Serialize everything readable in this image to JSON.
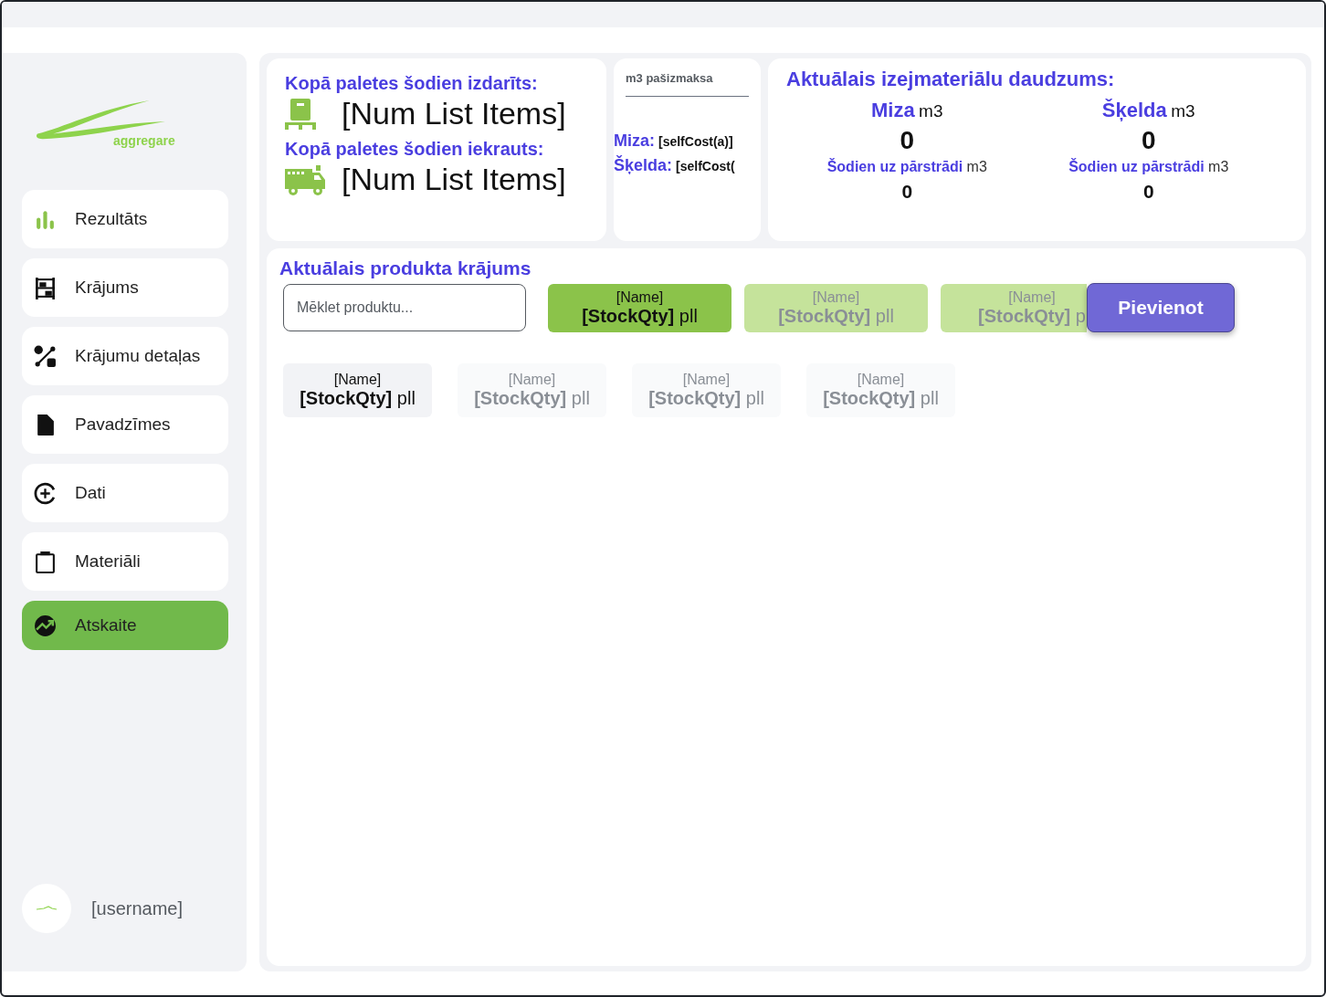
{
  "brand": {
    "name": "aggregare"
  },
  "nav": [
    {
      "label": "Rezultāts",
      "kind": "bars",
      "selected": false
    },
    {
      "label": "Krājums",
      "kind": "shelf",
      "selected": false
    },
    {
      "label": "Krājumu detaļas",
      "kind": "shapes",
      "selected": false
    },
    {
      "label": "Pavadzīmes",
      "kind": "file",
      "selected": false
    },
    {
      "label": "Dati",
      "kind": "circleplus",
      "selected": false
    },
    {
      "label": "Materiāli",
      "kind": "clipboard",
      "selected": false
    },
    {
      "label": "Atskaite",
      "kind": "chart",
      "selected": true
    }
  ],
  "user": {
    "name": "[username]"
  },
  "pallets": [
    {
      "title": "Kopā paletes šodien izdarīts:",
      "kind": "pallet",
      "value": "[Num List Items]"
    },
    {
      "title": "Kopā paletes šodien iekrauts:",
      "kind": "truck",
      "value": "[Num List Items]"
    }
  ],
  "self_cost": {
    "title": "m3 pašizmaksa",
    "rows": [
      {
        "label": "Miza:",
        "value": "[selfCost(a)]"
      },
      {
        "label": "Šķelda:",
        "value": "[selfCost("
      }
    ]
  },
  "materials": {
    "title": "Aktuālais izejmateriālu daudzums:",
    "items": [
      {
        "name": "Miza",
        "unit": "m3",
        "amount": "0",
        "today_label": "Šodien uz pārstrādi",
        "today_unit": "m3",
        "today_amount": "0"
      },
      {
        "name": "Šķelda",
        "unit": "m3",
        "amount": "0",
        "today_label": "Šodien uz pārstrādi",
        "today_unit": "m3",
        "today_amount": "0"
      }
    ]
  },
  "stock": {
    "title": "Aktuālais produkta krājums",
    "search": {
      "placeholder": "Mēklet produktu..."
    },
    "top_chips": [
      {
        "name": "[Name]",
        "qty": "[StockQty]",
        "unit": "pll",
        "selected": true
      },
      {
        "name": "[Name]",
        "qty": "[StockQty]",
        "unit": "pll",
        "selected": false
      },
      {
        "name": "[Name]",
        "qty": "[StockQty]",
        "unit": "p",
        "selected": false
      }
    ],
    "add_button": "Pievienot",
    "chips": [
      {
        "name": "[Name]",
        "qty": "[StockQty]",
        "unit": "pll",
        "selected": true
      },
      {
        "name": "[Name]",
        "qty": "[StockQty]",
        "unit": "pll",
        "selected": false
      },
      {
        "name": "[Name]",
        "qty": "[StockQty]",
        "unit": "pll",
        "selected": false
      },
      {
        "name": "[Name]",
        "qty": "[StockQty]",
        "unit": "pll",
        "selected": false
      }
    ]
  }
}
